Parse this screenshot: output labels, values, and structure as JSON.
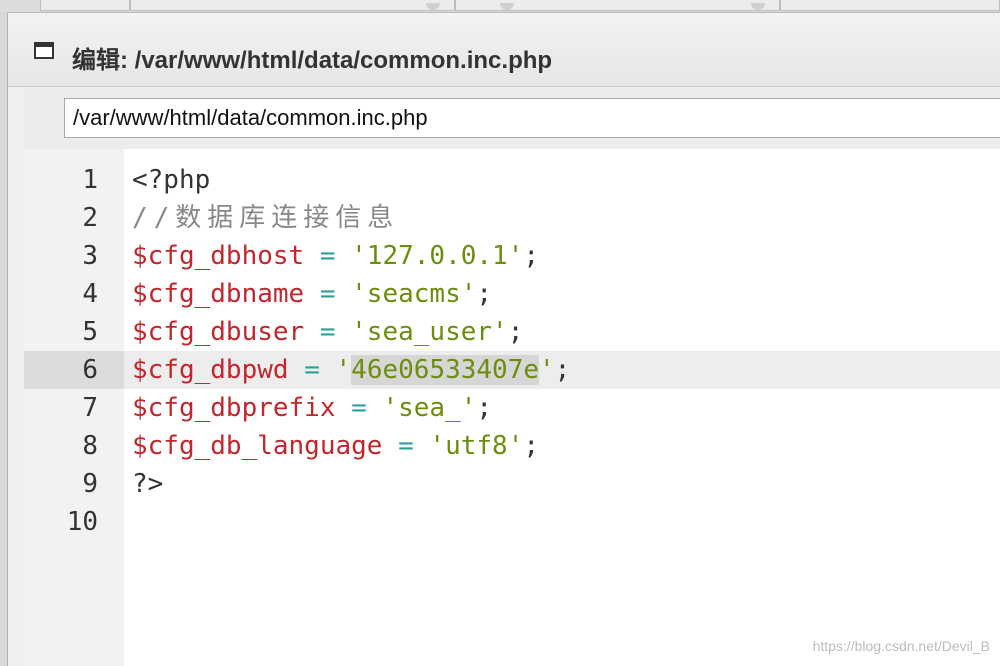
{
  "window": {
    "title": "编辑: /var/www/html/data/common.inc.php"
  },
  "path_field": {
    "value": "/var/www/html/data/common.inc.php"
  },
  "editor": {
    "lines": [
      {
        "number": "1",
        "tokens": [
          {
            "text": "<?php",
            "kind": "plain"
          }
        ]
      },
      {
        "number": "2",
        "tokens": [
          {
            "text": "//数据库连接信息",
            "kind": "comment"
          }
        ]
      },
      {
        "number": "3",
        "tokens": [
          {
            "text": "$cfg_dbhost",
            "kind": "var"
          },
          {
            "text": " = ",
            "kind": "op"
          },
          {
            "text": "'127.0.0.1'",
            "kind": "str"
          },
          {
            "text": ";",
            "kind": "plain"
          }
        ]
      },
      {
        "number": "4",
        "tokens": [
          {
            "text": "$cfg_dbname",
            "kind": "var"
          },
          {
            "text": " = ",
            "kind": "op"
          },
          {
            "text": "'seacms'",
            "kind": "str"
          },
          {
            "text": ";",
            "kind": "plain"
          }
        ]
      },
      {
        "number": "5",
        "tokens": [
          {
            "text": "$cfg_dbuser",
            "kind": "var"
          },
          {
            "text": " = ",
            "kind": "op"
          },
          {
            "text": "'sea_user'",
            "kind": "str"
          },
          {
            "text": ";",
            "kind": "plain"
          }
        ]
      },
      {
        "number": "6",
        "active": true,
        "tokens": [
          {
            "text": "$cfg_dbpwd",
            "kind": "var"
          },
          {
            "text": " = ",
            "kind": "op"
          },
          {
            "text": "'",
            "kind": "str"
          },
          {
            "text": "46e06533407e",
            "kind": "str",
            "selected": true
          },
          {
            "text": "'",
            "kind": "str"
          },
          {
            "text": ";",
            "kind": "plain"
          }
        ]
      },
      {
        "number": "7",
        "tokens": [
          {
            "text": "$cfg_dbprefix",
            "kind": "var"
          },
          {
            "text": " = ",
            "kind": "op"
          },
          {
            "text": "'sea_'",
            "kind": "str"
          },
          {
            "text": ";",
            "kind": "plain"
          }
        ]
      },
      {
        "number": "8",
        "tokens": [
          {
            "text": "$cfg_db_language",
            "kind": "var"
          },
          {
            "text": " = ",
            "kind": "op"
          },
          {
            "text": "'utf8'",
            "kind": "str"
          },
          {
            "text": ";",
            "kind": "plain"
          }
        ]
      },
      {
        "number": "9",
        "tokens": [
          {
            "text": "?>",
            "kind": "plain"
          }
        ]
      },
      {
        "number": "10",
        "tokens": []
      }
    ]
  },
  "watermark": "https://blog.csdn.net/Devil_B",
  "colors": {
    "variable": "#c1272d",
    "operator": "#2aa198",
    "string": "#6b8e0f",
    "comment": "#888888"
  },
  "icons": {
    "window": "window-icon"
  }
}
